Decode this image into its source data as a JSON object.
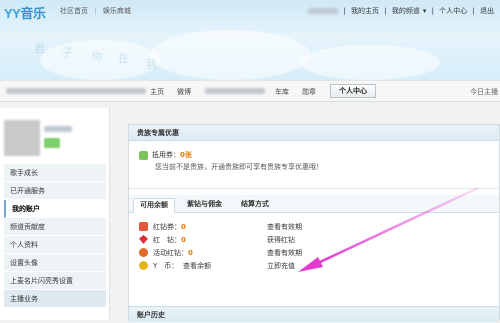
{
  "header": {
    "logo_prefix": "YY",
    "logo_suffix": "音乐",
    "nav": [
      "社区首页",
      "娱乐商城"
    ],
    "right_links": [
      "我的主页",
      "我的频道",
      "个人中心",
      "退出"
    ],
    "watermark_words": [
      "君",
      "子",
      "你",
      "在",
      "我"
    ]
  },
  "navbar": {
    "items": [
      "主页",
      "微博",
      "相册",
      "车库",
      "勋章"
    ],
    "active": "个人中心",
    "today": "今日主播"
  },
  "sidebar": {
    "menu": [
      {
        "label": "歌手成长",
        "kind": "item"
      },
      {
        "label": "已开通服务",
        "kind": "item"
      },
      {
        "label": "我的账户",
        "kind": "current"
      },
      {
        "label": "频道贡献度",
        "kind": "item"
      },
      {
        "label": "个人资料",
        "kind": "item"
      },
      {
        "label": "设置头像",
        "kind": "item"
      },
      {
        "label": "上麦名片闪亮秀设置",
        "kind": "item"
      },
      {
        "label": "主播业务",
        "kind": "group"
      }
    ]
  },
  "main": {
    "noble_title": "贵族专属优惠",
    "coupon_label": "抵用券：",
    "coupon_value": "0张",
    "noble_note": "您当前不是贵族，开通贵族即可享有贵族专享优惠哦！",
    "tabs": [
      "可用余额",
      "紫钻与佣金",
      "结算方式"
    ],
    "balances": [
      {
        "label": "红钻券：",
        "value": "0",
        "link": "查看有效期",
        "color": "#e05a3a"
      },
      {
        "label": "红　钻：",
        "value": "0",
        "link": "获得红钻",
        "color": "#e0303a"
      },
      {
        "label": "活动红钻：",
        "value": "0",
        "link": "查看有效期",
        "color": "#e06a2a"
      },
      {
        "label": "Y　币：",
        "value": "",
        "extra": "查看余额",
        "link": "立即充值",
        "color": "#e6b21a"
      }
    ],
    "history_title": "账户历史"
  },
  "colors": {
    "accent": "#3aa0d8",
    "arrow": "#e23bd0",
    "orange": "#e57c00"
  }
}
